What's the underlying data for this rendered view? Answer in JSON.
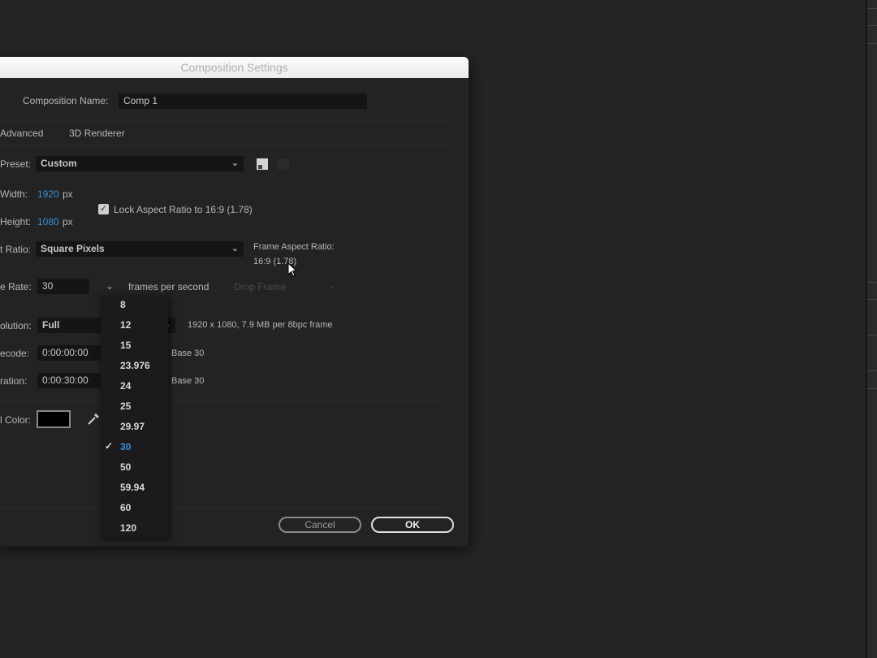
{
  "dialog": {
    "title": "Composition Settings",
    "composition_name_label": "Composition Name:",
    "composition_name_value": "Comp 1",
    "tabs": [
      {
        "label": "Advanced"
      },
      {
        "label": "3D Renderer"
      }
    ],
    "preset": {
      "label": "Preset:",
      "value": "Custom"
    },
    "width": {
      "label": "Width:",
      "value": "1920",
      "unit": "px"
    },
    "height": {
      "label": "Height:",
      "value": "1080",
      "unit": "px"
    },
    "lock_aspect": {
      "label": "Lock Aspect Ratio to 16:9 (1.78)",
      "checked": true
    },
    "pixel_aspect": {
      "label": "t Ratio:",
      "value": "Square Pixels"
    },
    "frame_aspect": {
      "label": "Frame Aspect Ratio:",
      "value": "16:9 (1.78)"
    },
    "frame_rate": {
      "label": "e Rate:",
      "value": "30",
      "unit_label": "frames per second",
      "drop_frame": "Drop Frame"
    },
    "resolution": {
      "label": "olution:",
      "value": "Full",
      "info": "1920 x 1080, 7.9 MB per 8bpc frame"
    },
    "start_timecode": {
      "label": "ecode:",
      "value": "0:00:00:00",
      "base": "Base 30"
    },
    "duration": {
      "label": "ration:",
      "value": "0:00:30:00",
      "base": "Base 30"
    },
    "background_color": {
      "label": "l Color:",
      "color": "#000000"
    },
    "buttons": {
      "cancel": "Cancel",
      "ok": "OK"
    }
  },
  "frame_rate_dropdown": {
    "options": [
      "8",
      "12",
      "15",
      "23.976",
      "24",
      "25",
      "29.97",
      "30",
      "50",
      "59.94",
      "60",
      "120"
    ],
    "selected": "30",
    "check_glyph": "✓"
  },
  "colors": {
    "accent": "#3c8fd6",
    "background": "#252525",
    "dialog": "#232323"
  }
}
